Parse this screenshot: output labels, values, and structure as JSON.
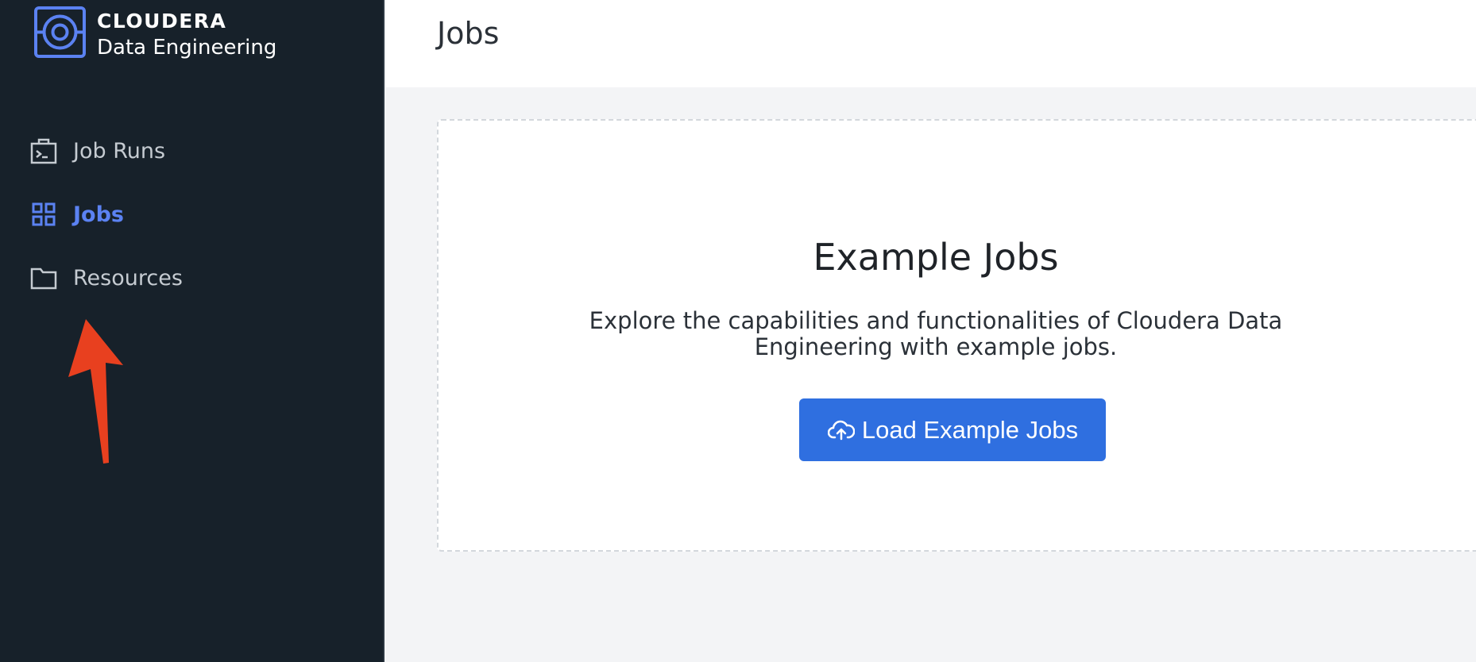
{
  "brand": {
    "company": "CLOUDERA",
    "product": "Data Engineering"
  },
  "sidebar": {
    "items": [
      {
        "label": "Job Runs",
        "icon": "terminal-briefcase-icon",
        "active": false
      },
      {
        "label": "Jobs",
        "icon": "grid-icon",
        "active": true
      },
      {
        "label": "Resources",
        "icon": "folder-icon",
        "active": false
      }
    ]
  },
  "header": {
    "title": "Jobs"
  },
  "main": {
    "card": {
      "title": "Example Jobs",
      "description": "Explore the capabilities and functionalities of Cloudera Data Engineering with example jobs.",
      "button_label": "Load Example Jobs",
      "button_icon": "cloud-upload-icon"
    }
  },
  "colors": {
    "sidebar_bg": "#17212a",
    "accent": "#5b82f2",
    "button_bg": "#2f6fe0",
    "annotation_arrow": "#e8401f"
  }
}
